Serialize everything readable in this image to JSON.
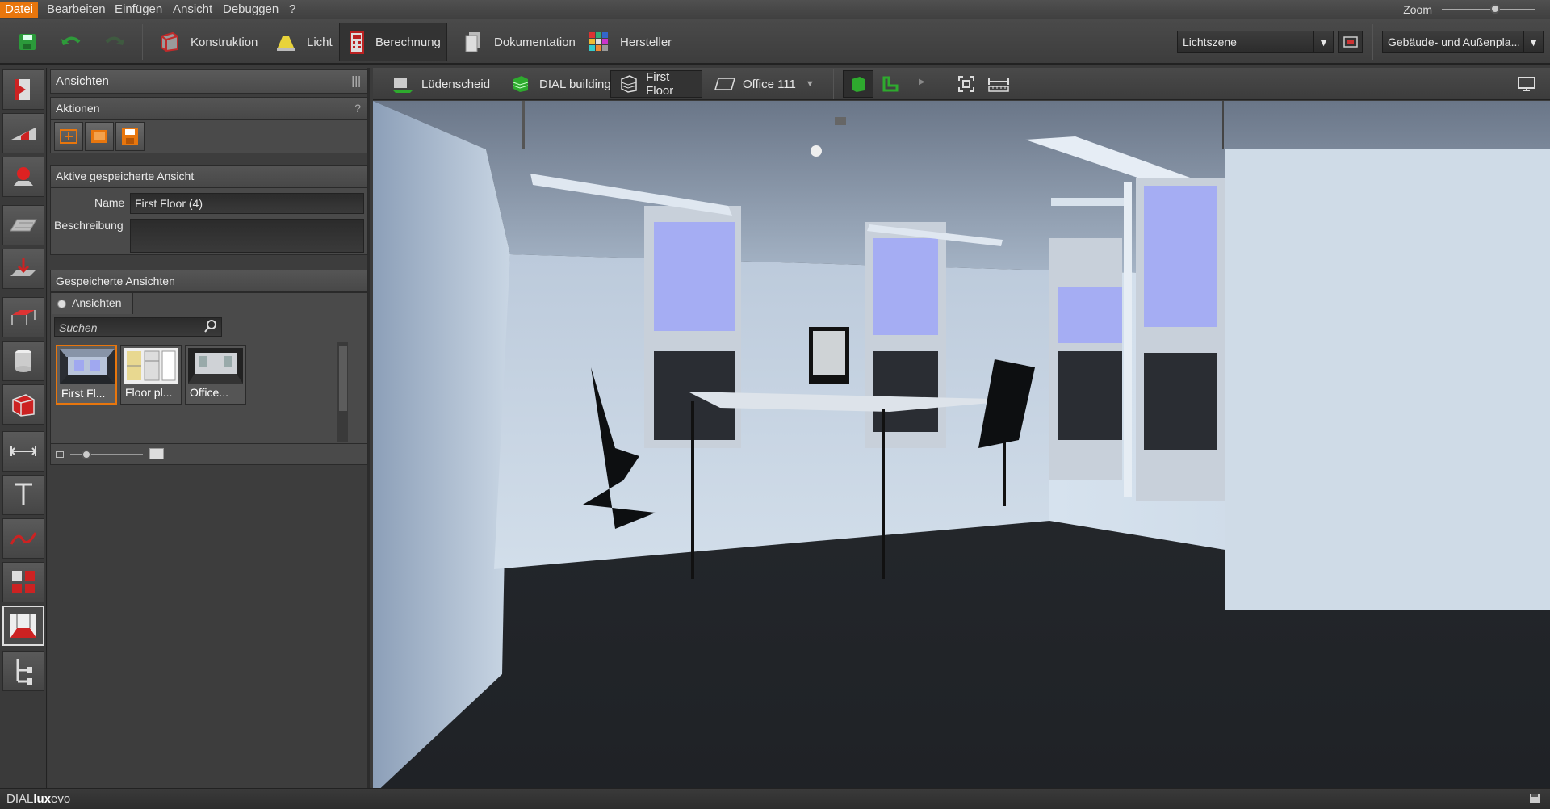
{
  "menubar": {
    "items": [
      {
        "label": "Datei",
        "active": true
      },
      {
        "label": "Bearbeiten"
      },
      {
        "label": "Einfügen"
      },
      {
        "label": "Ansicht"
      },
      {
        "label": "Debuggen"
      },
      {
        "label": "?"
      }
    ],
    "zoom_label": "Zoom"
  },
  "toolbar": {
    "tabs": [
      {
        "label": "Konstruktion",
        "icon": "construction-icon"
      },
      {
        "label": "Licht",
        "icon": "light-icon"
      },
      {
        "label": "Berechnung",
        "icon": "calculation-icon",
        "active": true
      },
      {
        "label": "Dokumentation",
        "icon": "documentation-icon"
      },
      {
        "label": "Hersteller",
        "icon": "manufacturer-icon"
      }
    ],
    "light_scene": "Lichtszene",
    "building_select": "Gebäude- und Außenpla..."
  },
  "panel": {
    "title": "Ansichten",
    "actions_title": "Aktionen",
    "help_label": "?",
    "active_view_title": "Aktive gespeicherte Ansicht",
    "name_label": "Name",
    "name_value": "First Floor (4)",
    "description_label": "Beschreibung",
    "description_value": "",
    "saved_views_title": "Gespeicherte Ansichten",
    "filter_label": "Ansichten",
    "search_placeholder": "Suchen",
    "thumbnails": [
      {
        "caption": "First Fl...",
        "selected": true
      },
      {
        "caption": "Floor pl..."
      },
      {
        "caption": "Office..."
      }
    ]
  },
  "viewport_toolbar": {
    "breadcrumbs": [
      {
        "label": "Lüdenscheid",
        "icon": "site-icon"
      },
      {
        "label": "DIAL building",
        "icon": "building-icon"
      },
      {
        "label": "First Floor",
        "icon": "floor-icon",
        "active": true
      },
      {
        "label": "Office 111",
        "icon": "room-icon"
      }
    ]
  },
  "status": {
    "brand_prefix": "DIAL",
    "brand_bold": "lux",
    "brand_suffix": "evo"
  },
  "colors": {
    "accent": "#e8760d",
    "toolbar_bg": "#454545",
    "green": "#2eaa2e",
    "red": "#c8202a"
  }
}
